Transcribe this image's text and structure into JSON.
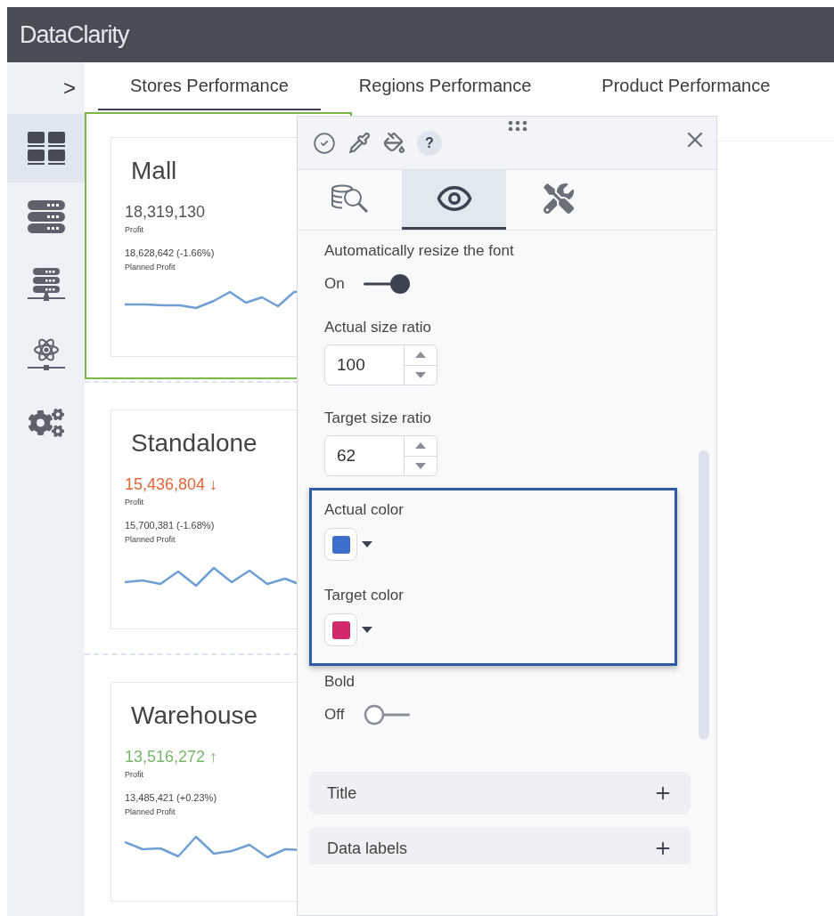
{
  "app": {
    "title": "DataClarity"
  },
  "sidebar": {
    "toggle": ">",
    "items": [
      {
        "kind": "dashboards",
        "selected": true
      },
      {
        "kind": "databases",
        "selected": false
      },
      {
        "kind": "servers",
        "selected": false
      },
      {
        "kind": "science",
        "selected": false
      },
      {
        "kind": "settings",
        "selected": false
      }
    ]
  },
  "tabs": [
    {
      "label": "Stores Performance",
      "selected": true
    },
    {
      "label": "Regions Performance",
      "selected": false
    },
    {
      "label": "Product Performance",
      "selected": false
    }
  ],
  "tiles": [
    {
      "title": "Mall",
      "value": "18,319,130",
      "color": "#555555",
      "value_label": "Profit",
      "target": "18,628,642 (-1.66%)",
      "target_label": "Planned Profit",
      "selected": true
    },
    {
      "title": "Standalone",
      "value": "15,436,804",
      "arrow": "↓",
      "color": "#e0663a",
      "value_label": "Profit",
      "target": "15,700,381 (-1.68%)",
      "target_label": "Planned Profit",
      "selected": false
    },
    {
      "title": "Warehouse",
      "value": "13,516,272",
      "arrow": "↑",
      "color": "#7cb66c",
      "value_label": "Profit",
      "target": "13,485,421 (+0.23%)",
      "target_label": "Planned Profit",
      "selected": false
    }
  ],
  "panel": {
    "toolbar": [
      {
        "kind": "check"
      },
      {
        "kind": "eyedropper"
      },
      {
        "kind": "paint"
      },
      {
        "kind": "help",
        "label": "?"
      }
    ],
    "tabs": [
      {
        "kind": "data",
        "selected": false
      },
      {
        "kind": "appearance",
        "selected": true
      },
      {
        "kind": "tools",
        "selected": false
      }
    ],
    "settings": [
      {
        "kind": "toggle",
        "label": "Automatically resize the font",
        "state_label": "On",
        "on": true
      },
      {
        "kind": "number",
        "label": "Actual size ratio",
        "value": "100"
      },
      {
        "kind": "number",
        "label": "Target size ratio",
        "value": "62"
      },
      {
        "kind": "group",
        "highlighted": true,
        "items": [
          {
            "kind": "color",
            "label": "Actual color",
            "color": "#3f6fcc"
          },
          {
            "kind": "color",
            "label": "Target color",
            "color": "#d0286b"
          }
        ]
      },
      {
        "kind": "toggle",
        "label": "Bold",
        "state_label": "Off",
        "on": false
      }
    ],
    "sections": [
      {
        "label": "Title",
        "expanded": false
      },
      {
        "label": "Data labels",
        "expanded": false
      }
    ]
  }
}
